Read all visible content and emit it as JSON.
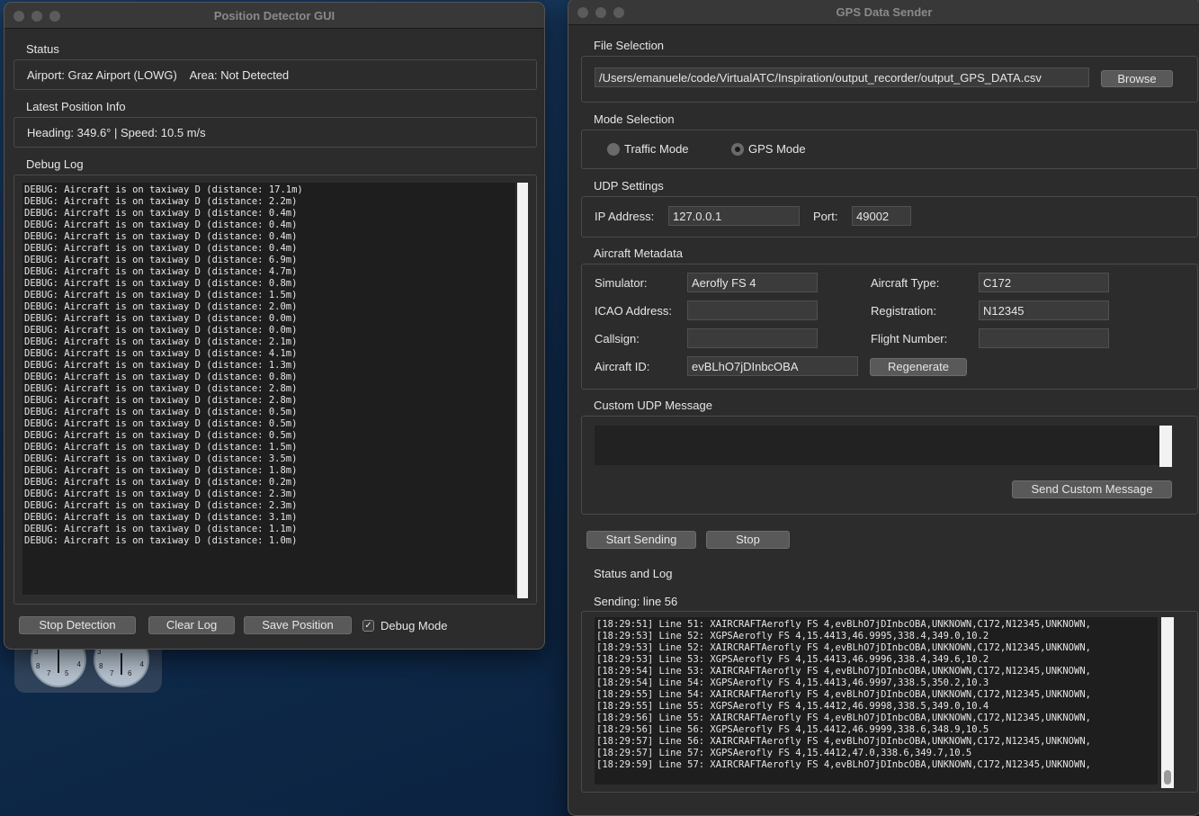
{
  "left_window": {
    "title": "Position Detector GUI",
    "status_label": "Status",
    "status_text": "Airport: Graz Airport (LOWG)    Area: Not Detected",
    "latest_label": "Latest Position Info",
    "latest_text": "Heading: 349.6° | Speed: 10.5 m/s",
    "debug_label": "Debug Log",
    "debug_lines": [
      "DEBUG: Aircraft is on taxiway D (distance: 17.1m)",
      "DEBUG: Aircraft is on taxiway D (distance: 2.2m)",
      "DEBUG: Aircraft is on taxiway D (distance: 0.4m)",
      "DEBUG: Aircraft is on taxiway D (distance: 0.4m)",
      "DEBUG: Aircraft is on taxiway D (distance: 0.4m)",
      "DEBUG: Aircraft is on taxiway D (distance: 0.4m)",
      "DEBUG: Aircraft is on taxiway D (distance: 6.9m)",
      "DEBUG: Aircraft is on taxiway D (distance: 4.7m)",
      "DEBUG: Aircraft is on taxiway D (distance: 0.8m)",
      "DEBUG: Aircraft is on taxiway D (distance: 1.5m)",
      "DEBUG: Aircraft is on taxiway D (distance: 2.0m)",
      "DEBUG: Aircraft is on taxiway D (distance: 0.0m)",
      "DEBUG: Aircraft is on taxiway D (distance: 0.0m)",
      "DEBUG: Aircraft is on taxiway D (distance: 2.1m)",
      "DEBUG: Aircraft is on taxiway D (distance: 4.1m)",
      "DEBUG: Aircraft is on taxiway D (distance: 1.3m)",
      "DEBUG: Aircraft is on taxiway D (distance: 0.8m)",
      "DEBUG: Aircraft is on taxiway D (distance: 2.8m)",
      "DEBUG: Aircraft is on taxiway D (distance: 2.8m)",
      "DEBUG: Aircraft is on taxiway D (distance: 0.5m)",
      "DEBUG: Aircraft is on taxiway D (distance: 0.5m)",
      "DEBUG: Aircraft is on taxiway D (distance: 0.5m)",
      "DEBUG: Aircraft is on taxiway D (distance: 1.5m)",
      "DEBUG: Aircraft is on taxiway D (distance: 3.5m)",
      "DEBUG: Aircraft is on taxiway D (distance: 1.8m)",
      "DEBUG: Aircraft is on taxiway D (distance: 0.2m)",
      "DEBUG: Aircraft is on taxiway D (distance: 2.3m)",
      "DEBUG: Aircraft is on taxiway D (distance: 2.3m)",
      "DEBUG: Aircraft is on taxiway D (distance: 3.1m)",
      "DEBUG: Aircraft is on taxiway D (distance: 1.1m)",
      "DEBUG: Aircraft is on taxiway D (distance: 1.0m)"
    ],
    "stop_detection": "Stop Detection",
    "clear_log": "Clear Log",
    "save_position": "Save Position",
    "debug_mode": "Debug Mode",
    "debug_mode_checked": true
  },
  "right_window": {
    "title": "GPS Data Sender",
    "file_label": "File Selection",
    "file_path": "/Users/emanuele/code/VirtualATC/Inspiration/output_recorder/output_GPS_DATA.csv",
    "browse": "Browse",
    "mode_label": "Mode Selection",
    "traffic_mode": "Traffic Mode",
    "gps_mode": "GPS Mode",
    "selected_mode": "GPS Mode",
    "udp_label": "UDP Settings",
    "ip_label": "IP Address:",
    "ip_value": "127.0.0.1",
    "port_label": "Port:",
    "port_value": "49002",
    "meta_label": "Aircraft Metadata",
    "simulator_label": "Simulator:",
    "simulator_value": "Aerofly FS 4",
    "aircraft_type_label": "Aircraft Type:",
    "aircraft_type_value": "C172",
    "icao_label": "ICAO Address:",
    "icao_value": "",
    "registration_label": "Registration:",
    "registration_value": "N12345",
    "callsign_label": "Callsign:",
    "callsign_value": "",
    "flight_number_label": "Flight Number:",
    "flight_number_value": "",
    "aircraft_id_label": "Aircraft ID:",
    "aircraft_id_value": "evBLhO7jDInbcOBA",
    "regenerate": "Regenerate",
    "custom_label": "Custom UDP Message",
    "custom_value": "",
    "send_custom": "Send Custom Message",
    "start_sending": "Start Sending",
    "stop": "Stop",
    "status_label": "Status and Log",
    "status_text": "Sending: line 56",
    "log_lines": [
      "[18:29:51] Line 51: XAIRCRAFTAerofly FS 4,evBLhO7jDInbcOBA,UNKNOWN,C172,N12345,UNKNOWN,",
      "[18:29:53] Line 52: XGPSAerofly FS 4,15.4413,46.9995,338.4,349.0,10.2",
      "[18:29:53] Line 52: XAIRCRAFTAerofly FS 4,evBLhO7jDInbcOBA,UNKNOWN,C172,N12345,UNKNOWN,",
      "[18:29:53] Line 53: XGPSAerofly FS 4,15.4413,46.9996,338.4,349.6,10.2",
      "[18:29:54] Line 53: XAIRCRAFTAerofly FS 4,evBLhO7jDInbcOBA,UNKNOWN,C172,N12345,UNKNOWN,",
      "[18:29:54] Line 54: XGPSAerofly FS 4,15.4413,46.9997,338.5,350.2,10.3",
      "[18:29:55] Line 54: XAIRCRAFTAerofly FS 4,evBLhO7jDInbcOBA,UNKNOWN,C172,N12345,UNKNOWN,",
      "[18:29:55] Line 55: XGPSAerofly FS 4,15.4412,46.9998,338.5,349.0,10.4",
      "[18:29:56] Line 55: XAIRCRAFTAerofly FS 4,evBLhO7jDInbcOBA,UNKNOWN,C172,N12345,UNKNOWN,",
      "[18:29:56] Line 56: XGPSAerofly FS 4,15.4412,46.9999,338.6,348.9,10.5",
      "[18:29:57] Line 56: XAIRCRAFTAerofly FS 4,evBLhO7jDInbcOBA,UNKNOWN,C172,N12345,UNKNOWN,",
      "[18:29:57] Line 57: XGPSAerofly FS 4,15.4412,47.0,338.6,349.7,10.5",
      "[18:29:59] Line 57: XAIRCRAFTAerofly FS 4,evBLhO7jDInbcOBA,UNKNOWN,C172,N12345,UNKNOWN,"
    ]
  },
  "desktop_widget": {
    "gauge1_labels": [
      "3",
      "4",
      "8",
      "7",
      "5"
    ],
    "gauge2_labels": [
      "3",
      "4",
      "8",
      "7",
      "6"
    ]
  }
}
